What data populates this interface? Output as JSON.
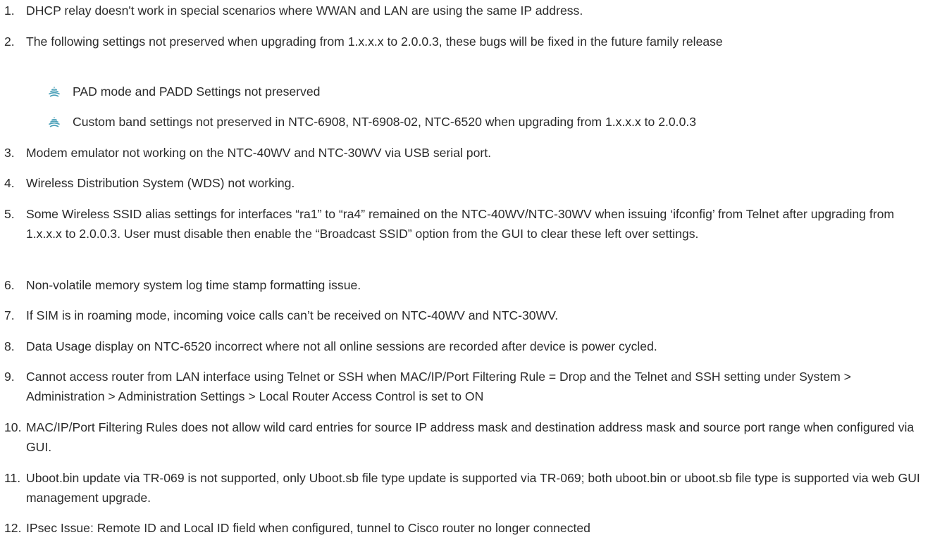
{
  "list": {
    "items": [
      {
        "num": "1.",
        "text": "DHCP relay doesn't work in special scenarios where WWAN and LAN are using the same IP address."
      },
      {
        "num": "2.",
        "text": "The following settings not preserved when upgrading from 1.x.x.x to 2.0.0.3, these bugs will be fixed in the future family release"
      },
      {
        "num": "3.",
        "text": "Modem emulator not working on the NTC-40WV and NTC-30WV via USB serial port."
      },
      {
        "num": "4.",
        "text": "Wireless Distribution System (WDS) not working."
      },
      {
        "num": "5.",
        "text": "Some Wireless SSID alias settings for interfaces “ra1” to “ra4” remained on the NTC-40WV/NTC-30WV when issuing ‘ifconfig’ from Telnet after upgrading from 1.x.x.x to 2.0.0.3. User must disable then enable the “Broadcast SSID” option from the GUI to clear these left over settings."
      },
      {
        "num": "6.",
        "text": "Non-volatile memory system log time stamp formatting issue."
      },
      {
        "num": "7.",
        "text": "If SIM is in roaming mode, incoming voice calls can’t be received on NTC-40WV and NTC-30WV."
      },
      {
        "num": "8.",
        "text": "Data Usage display on NTC-6520 incorrect where not all online sessions are recorded after device is power cycled."
      },
      {
        "num": "9.",
        "text": "Cannot access router from LAN interface using Telnet or SSH when MAC/IP/Port Filtering Rule = Drop and the Telnet and SSH setting under System > Administration > Administration Settings > Local Router Access Control is set to ON"
      },
      {
        "num": "10.",
        "text": "MAC/IP/Port Filtering Rules does not allow wild card entries for source IP address mask and destination address mask and source port range when configured via GUI."
      },
      {
        "num": "11.",
        "text": "Uboot.bin update via TR-069 is not supported, only Uboot.sb file type update is supported via TR-069; both uboot.bin or uboot.sb file type is supported via web GUI management upgrade."
      },
      {
        "num": "12.",
        "text": "IPsec Issue: Remote ID and Local ID field when configured, tunnel to Cisco router no longer connected"
      }
    ],
    "sub_items": [
      {
        "icon": "wifi-bullet-icon",
        "text": "PAD mode and PADD Settings not preserved"
      },
      {
        "icon": "wifi-bullet-icon",
        "text": "Custom band settings not preserved in NTC-6908, NT-6908-02, NTC-6520 when upgrading from 1.x.x.x to 2.0.0.3"
      }
    ]
  },
  "colors": {
    "text": "#2b2b2b",
    "bullet": "#4aa0b8"
  }
}
